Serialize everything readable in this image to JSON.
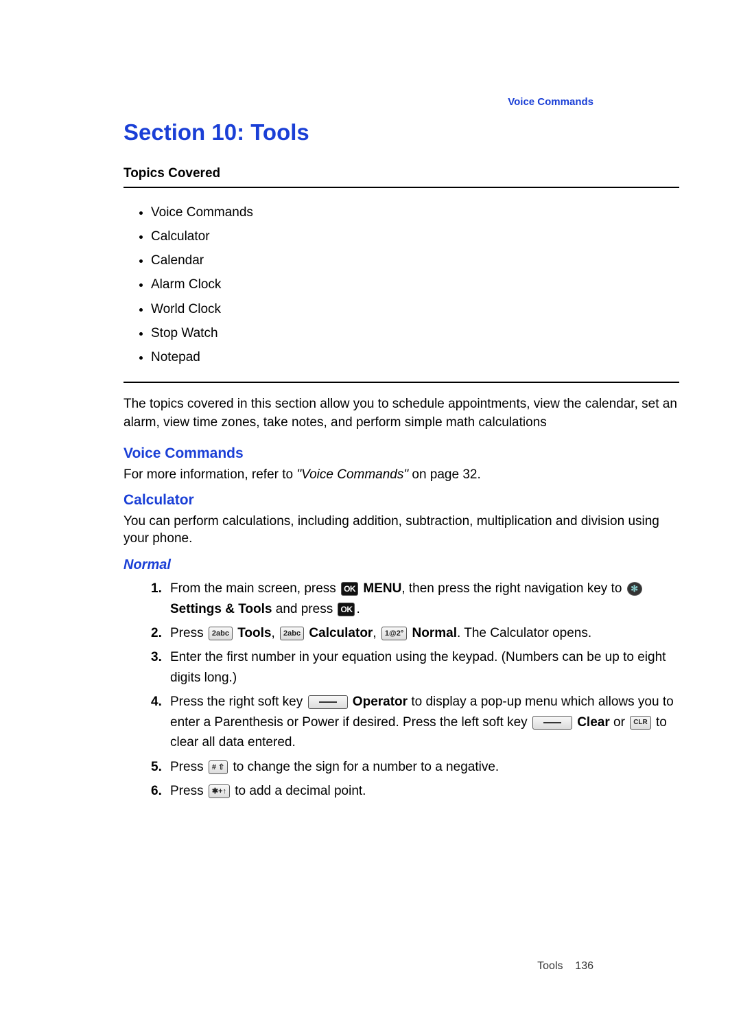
{
  "runningHeader": "Voice Commands",
  "sectionTitle": "Section 10: Tools",
  "topicsLabel": "Topics Covered",
  "topics": [
    "Voice Commands",
    "Calculator",
    "Calendar",
    "Alarm Clock",
    "World Clock",
    "Stop Watch",
    "Notepad"
  ],
  "intro": "The topics covered in this section allow you to schedule appointments, view the calendar, set an alarm, view time zones, take notes, and perform simple math calculations",
  "headings": {
    "voiceCommands": "Voice Commands",
    "calculator": "Calculator",
    "normal": "Normal"
  },
  "voiceCommands": {
    "prefix": "For more information, refer to ",
    "refTitle": "\"Voice Commands\"",
    "suffix": "  on page 32."
  },
  "calculatorIntro": "You can perform calculations, including addition, subtraction, multiplication and division using your phone.",
  "keys": {
    "ok": "OK",
    "gear": "✻",
    "two": "2abc",
    "one": "1@2°",
    "clr": "CLR",
    "hash": "# ⇧",
    "star": "✱+↑"
  },
  "steps": {
    "s1": {
      "a": "From the main screen, press ",
      "menu": " MENU",
      "b": ", then press the right navigation key to ",
      "settings": " Settings & Tools",
      "c": " and press ",
      "d": "."
    },
    "s2": {
      "a": "Press ",
      "tools": " Tools",
      "b": ", ",
      "calc": " Calculator",
      "c": ", ",
      "normal": " Normal",
      "d": ". The Calculator opens."
    },
    "s3": "Enter the first number in your equation using the keypad. (Numbers can be up to eight digits long.)",
    "s4": {
      "a": "Press the right soft key ",
      "op": " Operator",
      "b": " to display a pop-up menu which allows you to enter a Parenthesis or Power if desired. Press the left soft key ",
      "clear": " Clear",
      "c": " or ",
      "d": " to clear all data entered."
    },
    "s5": {
      "a": "Press ",
      "b": " to change the sign for a number to a negative."
    },
    "s6": {
      "a": "Press ",
      "b": " to add a decimal point."
    }
  },
  "footer": {
    "section": "Tools",
    "page": "136"
  }
}
